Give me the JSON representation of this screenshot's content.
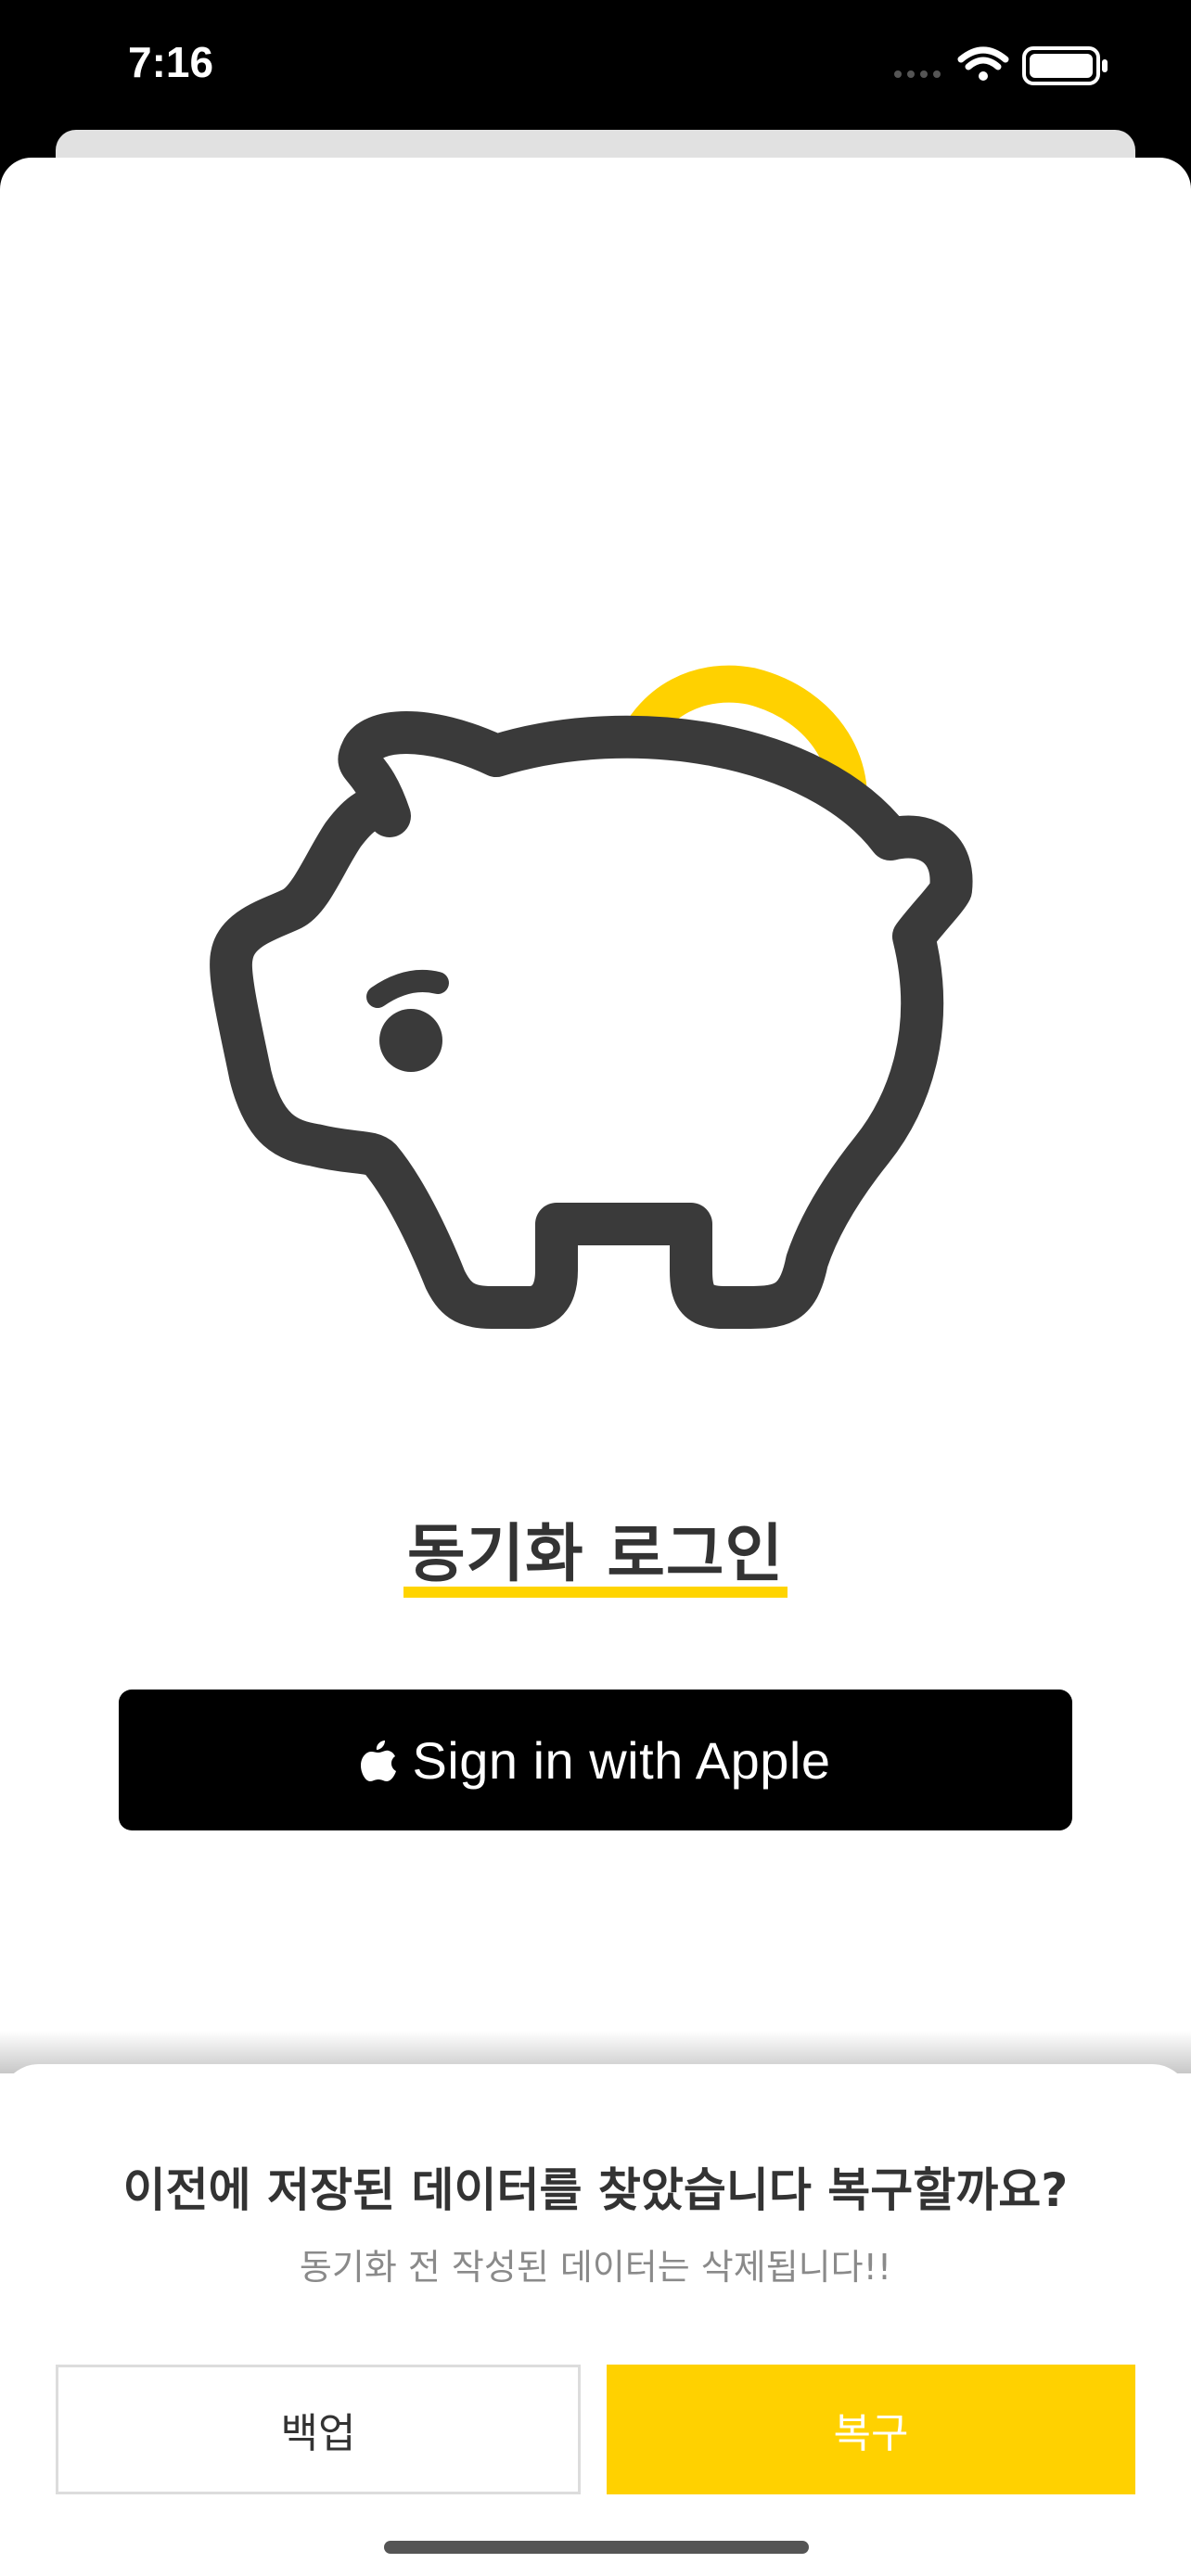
{
  "status_bar": {
    "time": "7:16"
  },
  "login": {
    "title": "동기화 로그인",
    "apple_button_label": "Sign in with Apple"
  },
  "restore_sheet": {
    "title": "이전에 저장된 데이터를 찾았습니다 복구할까요?",
    "subtitle": "동기화 전 작성된 데이터는 삭제됩니다!!",
    "backup_label": "백업",
    "restore_label": "복구"
  },
  "colors": {
    "accent_yellow": "#ffd100",
    "pig_stroke": "#3a3a3a",
    "button_black": "#000000"
  },
  "icons": [
    "wifi-icon",
    "battery-icon",
    "cellular-signal-icon",
    "apple-logo-icon",
    "piggy-bank-icon"
  ]
}
